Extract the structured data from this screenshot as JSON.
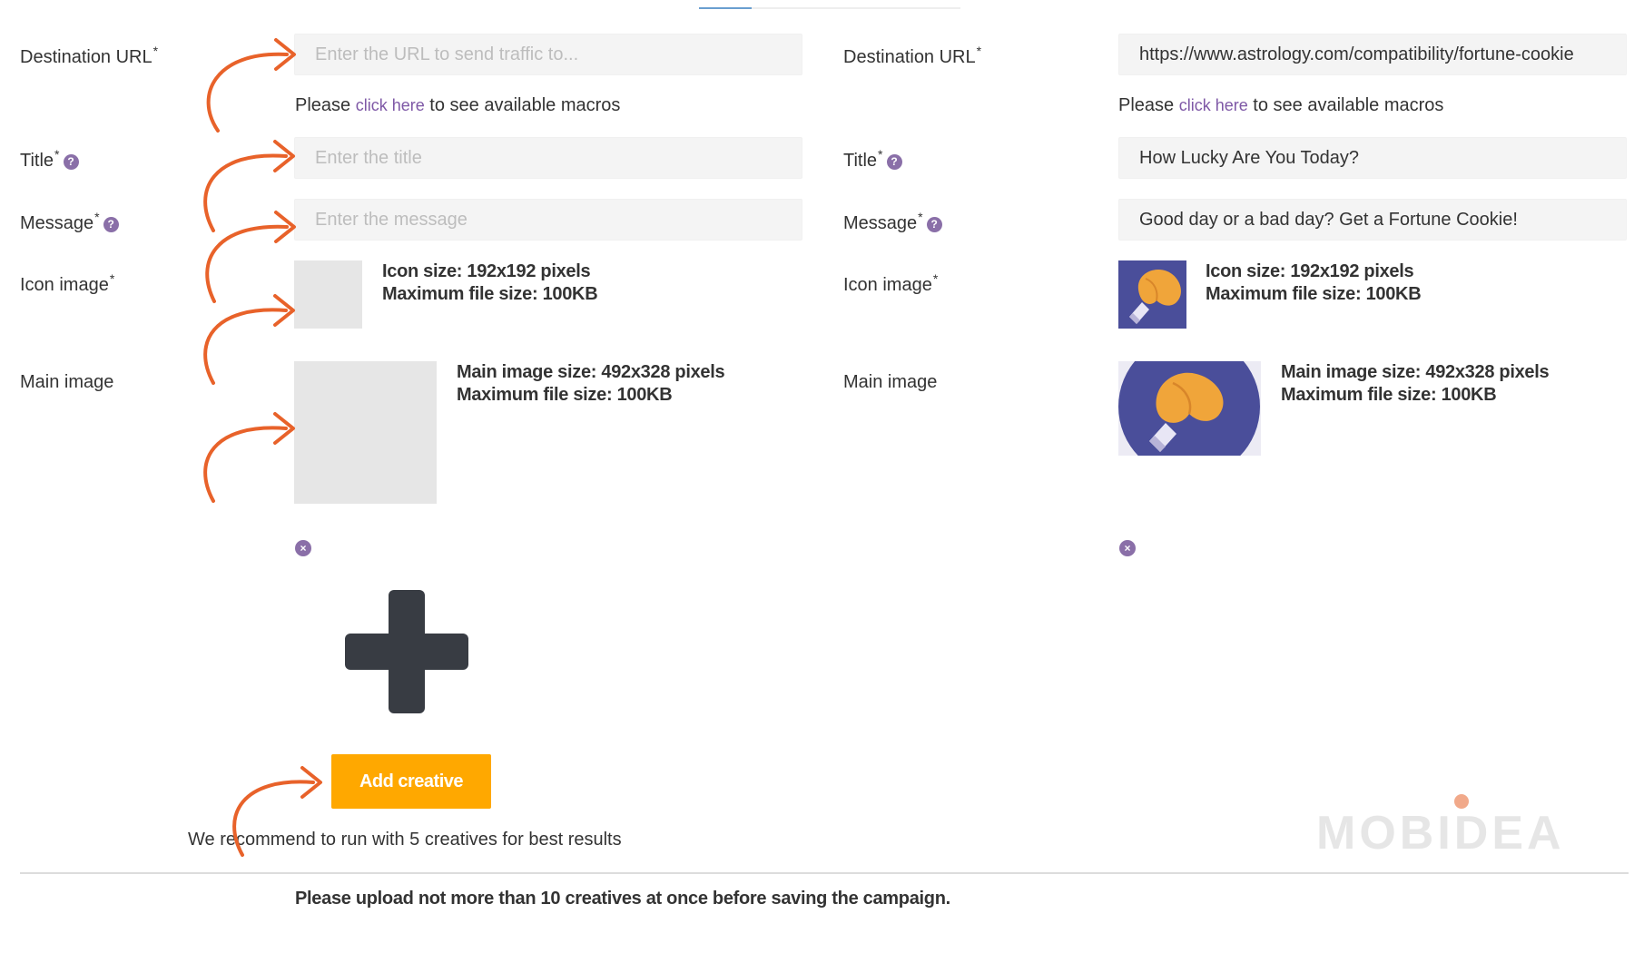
{
  "left": {
    "destination_label": "Destination URL",
    "destination_placeholder": "Enter the URL to send traffic to...",
    "macros_prefix": "Please ",
    "macros_link": "click here",
    "macros_suffix": " to see available macros",
    "title_label": "Title",
    "title_placeholder": "Enter the title",
    "message_label": "Message",
    "message_placeholder": "Enter the message",
    "icon_label": "Icon image",
    "icon_spec_line1": "Icon size: 192x192 pixels",
    "icon_spec_line2": "Maximum file size: 100KB",
    "main_label": "Main image",
    "main_spec_line1": "Main image size: 492x328 pixels",
    "main_spec_line2": "Maximum file size: 100KB"
  },
  "right": {
    "destination_label": "Destination URL",
    "destination_value": "https://www.astrology.com/compatibility/fortune-cookie",
    "macros_prefix": "Please ",
    "macros_link": "click here",
    "macros_suffix": " to see available macros",
    "title_label": "Title",
    "title_value": "How Lucky Are You Today?",
    "message_label": "Message",
    "message_value": "Good day or a bad day? Get a Fortune Cookie!",
    "icon_label": "Icon image",
    "icon_spec_line1": "Icon size: 192x192 pixels",
    "icon_spec_line2": "Maximum file size: 100KB",
    "main_label": "Main image",
    "main_spec_line1": "Main image size: 492x328 pixels",
    "main_spec_line2": "Maximum file size: 100KB"
  },
  "required_mark": "*",
  "help_glyph": "?",
  "remove_glyph": "×",
  "add_creative_label": "Add creative",
  "recommend_text": "We recommend to run with 5 creatives for best results",
  "upload_notice": "Please upload not more than 10 creatives at once before saving the campaign.",
  "watermark": "MOBIDEA",
  "colors": {
    "accent_orange": "#ffa800",
    "arrow_orange": "#e8622a",
    "link_purple": "#7e58a6",
    "icon_purple": "#8a6fa8",
    "image_blue": "#4a4e9a",
    "cookie": "#f0a53a",
    "plus_dark": "#383c43"
  },
  "icons": {
    "help": "question-circle-icon",
    "remove": "times-circle-icon",
    "add": "plus-icon",
    "image": "fortune-cookie-image"
  }
}
